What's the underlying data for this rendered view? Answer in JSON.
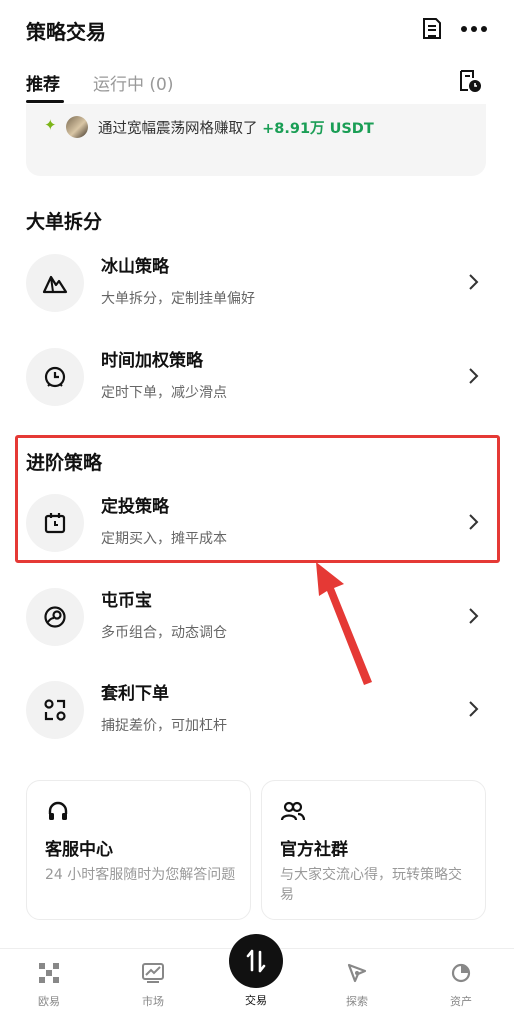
{
  "header": {
    "title": "策略交易",
    "doc_icon": "document-icon",
    "more_icon": "more-icon"
  },
  "tabs": {
    "recommended": "推荐",
    "running": "运行中 (0)",
    "history_icon": "order-history-icon"
  },
  "promo": {
    "text": "通过宽幅震荡网格赚取了",
    "amount": "+8.91万 USDT"
  },
  "sections": {
    "large_order": "大单拆分",
    "advanced": "进阶策略"
  },
  "items": [
    {
      "title": "冰山策略",
      "subtitle": "大单拆分，定制挂单偏好",
      "icon": "iceberg-icon"
    },
    {
      "title": "时间加权策略",
      "subtitle": "定时下单，减少滑点",
      "icon": "clock-icon"
    },
    {
      "title": "定投策略",
      "subtitle": "定期买入，摊平成本",
      "icon": "calendar-icon"
    },
    {
      "title": "屯币宝",
      "subtitle": "多币组合，动态调仓",
      "icon": "coin-portfolio-icon"
    },
    {
      "title": "套利下单",
      "subtitle": "捕捉差价，可加杠杆",
      "icon": "arbitrage-icon"
    }
  ],
  "cards": [
    {
      "title": "客服中心",
      "subtitle": "24 小时客服随时为您解答问题",
      "icon": "headset-icon"
    },
    {
      "title": "官方社群",
      "subtitle": "与大家交流心得，玩转策略交易",
      "icon": "community-icon"
    }
  ],
  "bottom_nav": [
    {
      "label": "欧易",
      "icon": "okx-logo-icon"
    },
    {
      "label": "市场",
      "icon": "market-chart-icon"
    },
    {
      "label": "交易",
      "icon": "trade-icon"
    },
    {
      "label": "探索",
      "icon": "explore-compass-icon"
    },
    {
      "label": "资产",
      "icon": "assets-pie-icon"
    }
  ],
  "colors": {
    "accent_green": "#1a9e55",
    "highlight_red": "#e53935"
  }
}
